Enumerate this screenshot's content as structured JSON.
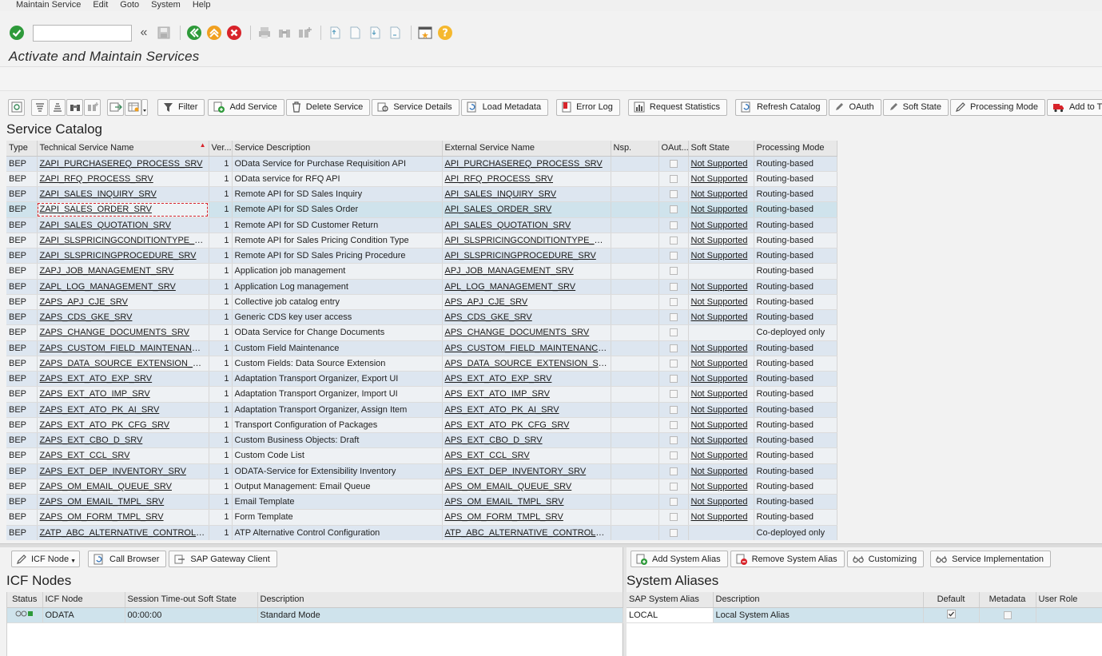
{
  "menu": [
    "Maintain Service",
    "Edit",
    "Goto",
    "System",
    "Help"
  ],
  "command_field": {
    "value": ""
  },
  "page_title": "Activate and Maintain Services",
  "toolbar": {
    "buttons": [
      {
        "label": "Filter",
        "icon": "filter-icon"
      },
      {
        "label": "Add Service",
        "icon": "add-icon"
      },
      {
        "label": "Delete Service",
        "icon": "trash-icon"
      },
      {
        "label": "Service Details",
        "icon": "details-icon"
      },
      {
        "label": "Load Metadata",
        "icon": "refresh-icon"
      },
      {
        "label": "Error Log",
        "icon": "error-log-icon"
      },
      {
        "label": "Request Statistics",
        "icon": "statistics-icon"
      },
      {
        "label": "Refresh Catalog",
        "icon": "refresh-icon"
      },
      {
        "label": "OAuth",
        "icon": "pen-icon"
      },
      {
        "label": "Soft State",
        "icon": "pen-icon"
      },
      {
        "label": "Processing Mode",
        "icon": "pencil-icon"
      },
      {
        "label": "Add to Transpo",
        "icon": "truck-icon"
      }
    ]
  },
  "catalog": {
    "title": "Service Catalog",
    "columns": [
      "Type",
      "Technical Service Name",
      "Ver...",
      "Service Description",
      "External Service Name",
      "Nsp.",
      "OAut...",
      "Soft State",
      "Processing Mode"
    ],
    "rows": [
      {
        "type": "BEP",
        "tech": "ZAPI_PURCHASEREQ_PROCESS_SRV",
        "ver": "1",
        "desc": "OData Service for Purchase Requisition API",
        "ext": "API_PURCHASEREQ_PROCESS_SRV",
        "nsp": "",
        "soft": "Not Supported",
        "mode": "Routing-based"
      },
      {
        "type": "BEP",
        "tech": "ZAPI_RFQ_PROCESS_SRV",
        "ver": "1",
        "desc": "OData service for RFQ API",
        "ext": "API_RFQ_PROCESS_SRV",
        "nsp": "",
        "soft": "Not Supported",
        "mode": "Routing-based"
      },
      {
        "type": "BEP",
        "tech": "ZAPI_SALES_INQUIRY_SRV",
        "ver": "1",
        "desc": "Remote API for SD Sales Inquiry",
        "ext": "API_SALES_INQUIRY_SRV",
        "nsp": "",
        "soft": "Not Supported",
        "mode": "Routing-based"
      },
      {
        "type": "BEP",
        "tech": "ZAPI_SALES_ORDER_SRV",
        "ver": "1",
        "desc": "Remote API for SD Sales Order",
        "ext": "API_SALES_ORDER_SRV",
        "nsp": "",
        "soft": "Not Supported",
        "mode": "Routing-based"
      },
      {
        "type": "BEP",
        "tech": "ZAPI_SALES_QUOTATION_SRV",
        "ver": "1",
        "desc": "Remote API for SD Customer Return",
        "ext": "API_SALES_QUOTATION_SRV",
        "nsp": "",
        "soft": "Not Supported",
        "mode": "Routing-based"
      },
      {
        "type": "BEP",
        "tech": "ZAPI_SLSPRICINGCONDITIONTYPE_SRV",
        "ver": "1",
        "desc": "Remote API for Sales Pricing Condition Type",
        "ext": "API_SLSPRICINGCONDITIONTYPE_SRV",
        "nsp": "",
        "soft": "Not Supported",
        "mode": "Routing-based"
      },
      {
        "type": "BEP",
        "tech": "ZAPI_SLSPRICINGPROCEDURE_SRV",
        "ver": "1",
        "desc": "Remote API for SD Sales Pricing Procedure",
        "ext": "API_SLSPRICINGPROCEDURE_SRV",
        "nsp": "",
        "soft": "Not Supported",
        "mode": "Routing-based"
      },
      {
        "type": "BEP",
        "tech": "ZAPJ_JOB_MANAGEMENT_SRV",
        "ver": "1",
        "desc": "Application job management",
        "ext": "APJ_JOB_MANAGEMENT_SRV",
        "nsp": "",
        "soft": "",
        "mode": "Routing-based"
      },
      {
        "type": "BEP",
        "tech": "ZAPL_LOG_MANAGEMENT_SRV",
        "ver": "1",
        "desc": "Application Log management",
        "ext": "APL_LOG_MANAGEMENT_SRV",
        "nsp": "",
        "soft": "Not Supported",
        "mode": "Routing-based"
      },
      {
        "type": "BEP",
        "tech": "ZAPS_APJ_CJE_SRV",
        "ver": "1",
        "desc": "Collective job catalog entry",
        "ext": "APS_APJ_CJE_SRV",
        "nsp": "",
        "soft": "Not Supported",
        "mode": "Routing-based"
      },
      {
        "type": "BEP",
        "tech": "ZAPS_CDS_GKE_SRV",
        "ver": "1",
        "desc": "Generic CDS key user access",
        "ext": "APS_CDS_GKE_SRV",
        "nsp": "",
        "soft": "Not Supported",
        "mode": "Routing-based"
      },
      {
        "type": "BEP",
        "tech": "ZAPS_CHANGE_DOCUMENTS_SRV",
        "ver": "1",
        "desc": "OData Service for Change Documents",
        "ext": "APS_CHANGE_DOCUMENTS_SRV",
        "nsp": "",
        "soft": "",
        "mode": "Co-deployed only"
      },
      {
        "type": "BEP",
        "tech": "ZAPS_CUSTOM_FIELD_MAINTENANCE_SR...",
        "ver": "1",
        "desc": "Custom Field Maintenance",
        "ext": "APS_CUSTOM_FIELD_MAINTENANCE_SRV",
        "nsp": "",
        "soft": "Not Supported",
        "mode": "Routing-based"
      },
      {
        "type": "BEP",
        "tech": "ZAPS_DATA_SOURCE_EXTENSION_SRV",
        "ver": "1",
        "desc": "Custom Fields: Data Source Extension",
        "ext": "APS_DATA_SOURCE_EXTENSION_SRV",
        "nsp": "",
        "soft": "Not Supported",
        "mode": "Routing-based"
      },
      {
        "type": "BEP",
        "tech": "ZAPS_EXT_ATO_EXP_SRV",
        "ver": "1",
        "desc": "Adaptation Transport Organizer, Export UI",
        "ext": "APS_EXT_ATO_EXP_SRV",
        "nsp": "",
        "soft": "Not Supported",
        "mode": "Routing-based"
      },
      {
        "type": "BEP",
        "tech": "ZAPS_EXT_ATO_IMP_SRV",
        "ver": "1",
        "desc": "Adaptation Transport Organizer, Import UI",
        "ext": "APS_EXT_ATO_IMP_SRV",
        "nsp": "",
        "soft": "Not Supported",
        "mode": "Routing-based"
      },
      {
        "type": "BEP",
        "tech": "ZAPS_EXT_ATO_PK_AI_SRV",
        "ver": "1",
        "desc": "Adaptation Transport Organizer, Assign Item",
        "ext": "APS_EXT_ATO_PK_AI_SRV",
        "nsp": "",
        "soft": "Not Supported",
        "mode": "Routing-based"
      },
      {
        "type": "BEP",
        "tech": "ZAPS_EXT_ATO_PK_CFG_SRV",
        "ver": "1",
        "desc": "Transport Configuration of Packages",
        "ext": "APS_EXT_ATO_PK_CFG_SRV",
        "nsp": "",
        "soft": "Not Supported",
        "mode": "Routing-based"
      },
      {
        "type": "BEP",
        "tech": "ZAPS_EXT_CBO_D_SRV",
        "ver": "1",
        "desc": "Custom Business Objects: Draft",
        "ext": "APS_EXT_CBO_D_SRV",
        "nsp": "",
        "soft": "Not Supported",
        "mode": "Routing-based"
      },
      {
        "type": "BEP",
        "tech": "ZAPS_EXT_CCL_SRV",
        "ver": "1",
        "desc": "Custom Code List",
        "ext": "APS_EXT_CCL_SRV",
        "nsp": "",
        "soft": "Not Supported",
        "mode": "Routing-based"
      },
      {
        "type": "BEP",
        "tech": "ZAPS_EXT_DEP_INVENTORY_SRV",
        "ver": "1",
        "desc": "ODATA-Service for Extensibility Inventory",
        "ext": "APS_EXT_DEP_INVENTORY_SRV",
        "nsp": "",
        "soft": "Not Supported",
        "mode": "Routing-based"
      },
      {
        "type": "BEP",
        "tech": "ZAPS_OM_EMAIL_QUEUE_SRV",
        "ver": "1",
        "desc": "Output Management: Email Queue",
        "ext": "APS_OM_EMAIL_QUEUE_SRV",
        "nsp": "",
        "soft": "Not Supported",
        "mode": "Routing-based"
      },
      {
        "type": "BEP",
        "tech": "ZAPS_OM_EMAIL_TMPL_SRV",
        "ver": "1",
        "desc": "Email Template",
        "ext": "APS_OM_EMAIL_TMPL_SRV",
        "nsp": "",
        "soft": "Not Supported",
        "mode": "Routing-based"
      },
      {
        "type": "BEP",
        "tech": "ZAPS_OM_FORM_TMPL_SRV",
        "ver": "1",
        "desc": "Form Template",
        "ext": "APS_OM_FORM_TMPL_SRV",
        "nsp": "",
        "soft": "Not Supported",
        "mode": "Routing-based"
      },
      {
        "type": "BEP",
        "tech": "ZATP_ABC_ALTERNATIVE_CONTROL_SRV",
        "ver": "1",
        "desc": "ATP Alternative Control Configuration",
        "ext": "ATP_ABC_ALTERNATIVE_CONTROL_SRV",
        "nsp": "",
        "soft": "",
        "mode": "Co-deployed only"
      }
    ]
  },
  "icf_toolbar": [
    {
      "label": "ICF Node",
      "icon": "pencil-icon"
    },
    {
      "label": "Call Browser",
      "icon": "browser-icon"
    },
    {
      "label": "SAP Gateway Client",
      "icon": "gateway-icon"
    }
  ],
  "alias_toolbar": [
    {
      "label": "Add System Alias",
      "icon": "add-icon"
    },
    {
      "label": "Remove System Alias",
      "icon": "remove-icon"
    },
    {
      "label": "Customizing",
      "icon": "glasses-icon"
    },
    {
      "label": "Service Implementation",
      "icon": "glasses-icon"
    }
  ],
  "icf_nodes": {
    "title": "ICF Nodes",
    "columns": [
      "Status",
      "ICF Node",
      "Session Time-out Soft State",
      "Description"
    ],
    "rows": [
      {
        "node": "ODATA",
        "timeout": "00:00:00",
        "desc": "Standard Mode"
      }
    ]
  },
  "system_aliases": {
    "title": "System Aliases",
    "columns": [
      "SAP System Alias",
      "Description",
      "Default",
      "Metadata",
      "User Role"
    ],
    "rows": [
      {
        "alias": "LOCAL",
        "desc": "Local System Alias",
        "user_role": ""
      }
    ]
  }
}
